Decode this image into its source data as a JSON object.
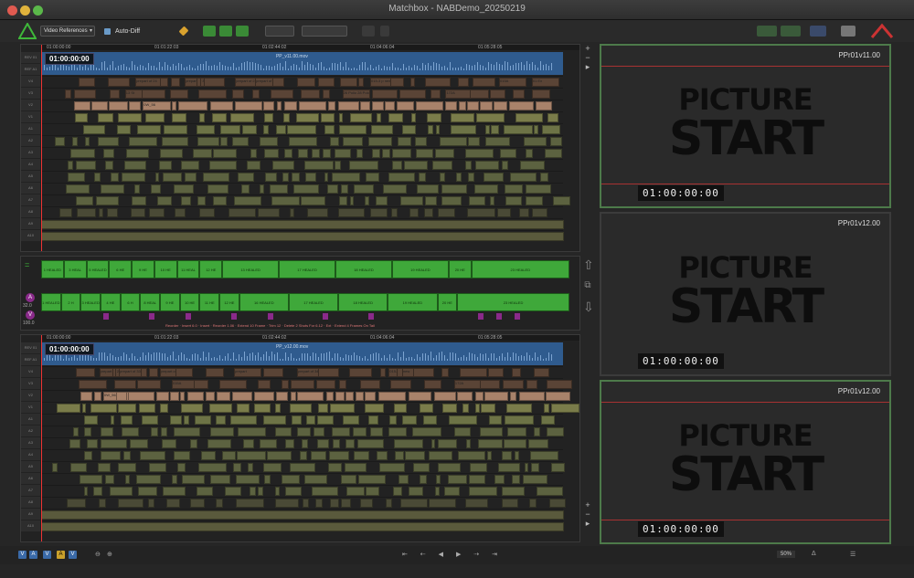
{
  "window": {
    "title": "Matchbox - NABDemo_20250219"
  },
  "toolbar": {
    "view_select": "Video References",
    "autodiff_label": "Auto-Diff"
  },
  "top_seq": {
    "timecode": "01:00:00:00",
    "track_names": [
      "REV 01",
      "REF A1",
      "V4",
      "V3",
      "V2",
      "V1",
      "A1",
      "A2",
      "A3",
      "A4",
      "A5",
      "A6",
      "A7",
      "A8",
      "A9",
      "A10"
    ],
    "ruler_ticks": [
      "01:00:00:00",
      "01:01:22:03",
      "01:02:44:02",
      "01:04:06:04",
      "01:05:28:05"
    ],
    "audio_clip": "PP_v11.00.mov",
    "clip_labels": [
      "prepart of 24",
      "prepart of 33",
      "prepart of 21",
      "prepart of 34",
      "015-3 p new",
      "015A",
      "01 Ex",
      "13 St",
      "26 Polio 28 Polom",
      "172A",
      "0W_56",
      "PP_v11_TempMix_51.wav",
      "PP_v11_TempMusic_20.wav"
    ]
  },
  "mid": {
    "top_row": [
      "1 HEALED",
      "3 HEAL",
      "5 HEALED",
      "6 HE",
      "9 HE",
      "10 HE",
      "11 HEAL",
      "12 HE",
      "13 HEALED",
      "17 HEALED",
      "18 HEALED",
      "19 HEALED",
      "20 HE",
      "23 HEALED"
    ],
    "bottom_row": [
      "1 HEALED",
      "2 H",
      "3 HEALED",
      "4 HE",
      "6 H",
      "8 HEAL",
      "9 HE",
      "10 HE",
      "11 HE",
      "12 HE",
      "16 HEALED",
      "17 HEALED",
      "18 HEALED",
      "19 HEALED",
      "20 HE",
      "23 HEALED"
    ],
    "zoom_a": "32.0",
    "zoom_v": "100.0",
    "change_notes": "Reorder  ·  Insert 6.0  ·  Insert  ·  Reorder 1.06  ·  Extend 10 Frame  ·  Trim 12  ·  Delete 2 Shots For 6.12  ·  Ext  ·  Extend 4 Frames On Tail"
  },
  "bottom_seq": {
    "timecode": "01:00:00:00",
    "track_names": [
      "REV 01",
      "REF A1",
      "V4",
      "V3",
      "V2",
      "V1",
      "A1",
      "A2",
      "A3",
      "A4",
      "A5",
      "A6",
      "A7",
      "A8",
      "A9",
      "A10"
    ],
    "ruler_ticks": [
      "01:00:00:00",
      "01:01:22:03",
      "01:02:44:02",
      "01:04:06:04",
      "01:05:28:05"
    ],
    "audio_clip": "PP_v12.00.mov",
    "clip_labels": [
      "prepart of 24",
      "prepart of 33",
      "prepart of 21",
      "prepart",
      "prepart of 34",
      "015-3 p new",
      "015A",
      "172A",
      "0W_56",
      "PP_v11_TempMix_51.wav",
      "PP_v11_TempMusic_20.wav"
    ]
  },
  "monitors": [
    {
      "label": "PPr01v11.00",
      "line1": "PICTURE",
      "line2": "START",
      "timecode": "01:00:00:00"
    },
    {
      "label": "PPr01v12.00",
      "line1": "PICTURE",
      "line2": "START",
      "timecode": "01:00:00:00"
    },
    {
      "label": "PPr01v12.00",
      "line1": "PICTURE",
      "line2": "START",
      "timecode": "01:00:00:00"
    }
  ],
  "bottombar": {
    "zoom": "50%"
  },
  "colors": {
    "accent_green": "#3fa83a",
    "audio_blue": "#2f5b8e",
    "clip_tan": "#a8826a",
    "clip_olive": "#6d7346",
    "red": "#c33"
  }
}
